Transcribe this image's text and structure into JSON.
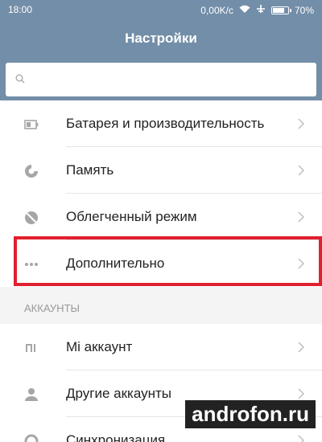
{
  "statusbar": {
    "time": "18:00",
    "speed": "0,00K/c",
    "battery": "70%"
  },
  "header": {
    "title": "Настройки"
  },
  "search": {
    "placeholder": ""
  },
  "items": [
    {
      "label": "Батарея и производительность",
      "icon": "battery-icon"
    },
    {
      "label": "Память",
      "icon": "storage-icon"
    },
    {
      "label": "Облегченный режим",
      "icon": "lite-mode-icon"
    },
    {
      "label": "Дополнительно",
      "icon": "more-dots-icon"
    }
  ],
  "accounts_section": {
    "title": "АККАУНТЫ"
  },
  "accounts": [
    {
      "label": "Mi аккаунт",
      "icon": "mi-icon"
    },
    {
      "label": "Другие аккаунты",
      "icon": "person-icon"
    },
    {
      "label": "Синхронизация",
      "icon": "sync-icon"
    }
  ],
  "watermark": "androfon.ru",
  "colors": {
    "header": "#738ea8",
    "highlight": "#e0202e"
  }
}
